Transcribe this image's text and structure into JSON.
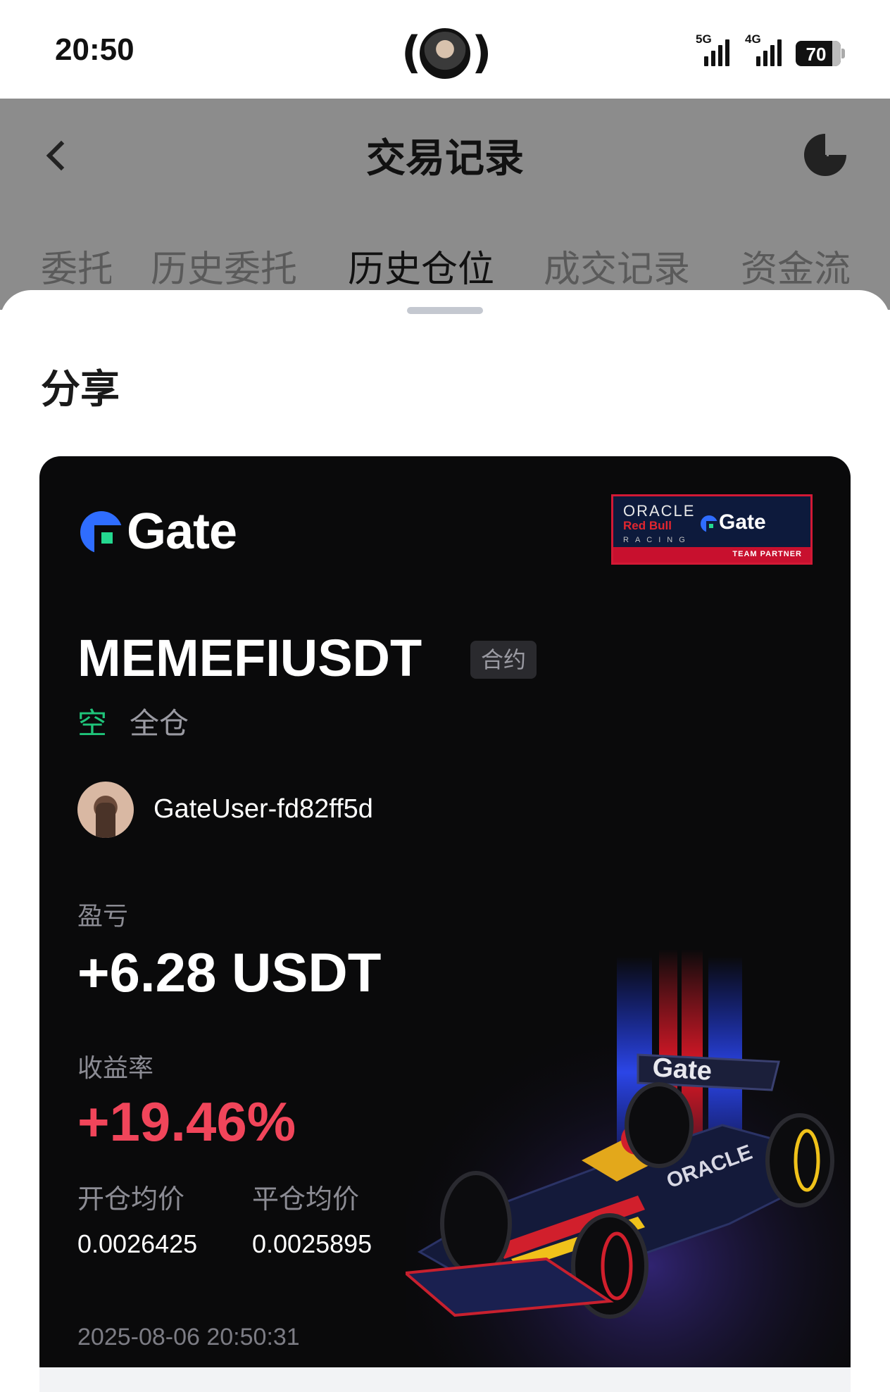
{
  "status_bar": {
    "time": "20:50",
    "signal_1": "5G",
    "signal_2": "4G",
    "battery": "70"
  },
  "header": {
    "title": "交易记录",
    "back_icon": "chevron-left-icon",
    "chart_icon": "pie-chart-icon"
  },
  "tabs": [
    {
      "label": "委托"
    },
    {
      "label": "历史委托"
    },
    {
      "label": "历史仓位"
    },
    {
      "label": "成交记录"
    },
    {
      "label": "资金流"
    }
  ],
  "sheet": {
    "title": "分享"
  },
  "card": {
    "brand": "Gate",
    "partner": {
      "oracle": "ORACLE",
      "redbull": "Red Bull",
      "racing": "RACING",
      "gate": "Gate",
      "team": "TEAM PARTNER"
    },
    "pair": "MEMEFIUSDT",
    "contract_badge": "合约",
    "side": "空",
    "margin_mode": "全仓",
    "username": "GateUser-fd82ff5d",
    "pnl_label": "盈亏",
    "pnl_value": "+6.28 USDT",
    "roi_label": "收益率",
    "roi_value": "+19.46%",
    "open_price_label": "开仓均价",
    "close_price_label": "平仓均价",
    "open_price": "0.0026425",
    "close_price": "0.0025895",
    "timestamp": "2025-08-06 20:50:31",
    "colors": {
      "profit_green": "#1fc47a",
      "roi_red": "#f1455a",
      "brand_blue": "#2f6dff"
    }
  }
}
